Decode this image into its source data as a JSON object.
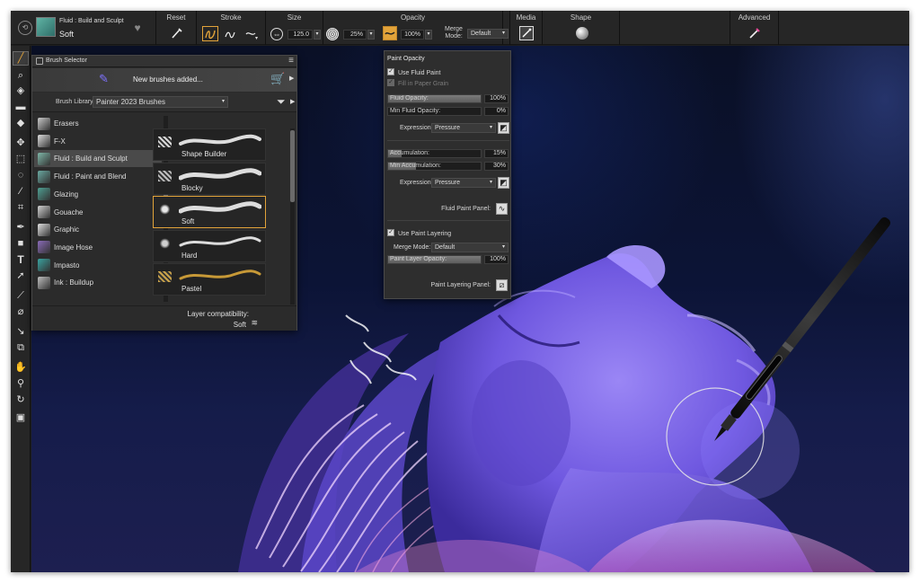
{
  "propbar": {
    "brush_category": "Fluid : Build and Sculpt",
    "brush_variant": "Soft",
    "sections": {
      "reset": "Reset",
      "stroke": "Stroke",
      "size": "Size",
      "opacity": "Opacity",
      "media": "Media",
      "shape": "Shape",
      "advanced": "Advanced"
    },
    "size_value": "125.0",
    "softness_value": "25%",
    "opacity_value": "100%",
    "merge_mode_label_1": "Merge",
    "merge_mode_label_2": "Mode:",
    "merge_mode_value": "Default",
    "chevron": "▾"
  },
  "toolbox": {
    "icons": [
      "brush-icon",
      "dropper-icon",
      "paint-bucket-icon",
      "fill-rect-icon",
      "eraser-icon",
      "transform-icon",
      "rect-select-icon",
      "lasso-icon",
      "magic-wand-icon",
      "crop-icon",
      "pen-icon",
      "shape-icon",
      "text-icon",
      "layer-adjuster-icon",
      "smudge-icon",
      "blender-icon",
      "dodge-icon",
      "clone-icon",
      "grabber-icon",
      "magnifier-icon",
      "rotate-icon",
      "navigator-icon"
    ]
  },
  "brush_selector": {
    "title": "Brush Selector",
    "banner_text": "New brushes added...",
    "library_label": "Brush Library:",
    "library_value": "Painter 2023 Brushes",
    "categories": [
      {
        "label": "Erasers",
        "color": "#c8c8c8"
      },
      {
        "label": "F-X",
        "color": "#dcdcdc"
      },
      {
        "label": "Fluid : Build and Sculpt",
        "color": "#7fb7a8"
      },
      {
        "label": "Fluid : Paint and Blend",
        "color": "#6aa9a1"
      },
      {
        "label": "Glazing",
        "color": "#4f9f92"
      },
      {
        "label": "Gouache",
        "color": "#d0d0d0"
      },
      {
        "label": "Graphic",
        "color": "#e0e0e0"
      },
      {
        "label": "Image Hose",
        "color": "#8a6bb8"
      },
      {
        "label": "Impasto",
        "color": "#3aa3a0"
      },
      {
        "label": "Ink : Buildup",
        "color": "#bdbdbd"
      }
    ],
    "active_category_index": 2,
    "variants": [
      {
        "label": "Shape Builder"
      },
      {
        "label": "Blocky"
      },
      {
        "label": "Soft"
      },
      {
        "label": "Hard"
      },
      {
        "label": "Pastel"
      }
    ],
    "active_variant_index": 2,
    "footer_label": "Layer compatibility:",
    "footer_value": "Soft",
    "colors": {
      "accent": "#e2a33a"
    }
  },
  "paint_opacity": {
    "title": "Paint Opacity",
    "use_fluid_paint": "Use Fluid Paint",
    "fill_in_paper_grain": "Fill in Paper Grain",
    "fluid_opacity": {
      "label": "Fluid Opacity:",
      "value": "100%",
      "fraction": 1.0
    },
    "min_fluid_opacity": {
      "label": "Min Fluid Opacity:",
      "value": "0%",
      "fraction": 0.0
    },
    "expression_label": "Expression:",
    "expression_value": "Pressure",
    "accumulation": {
      "label": "Accumulation:",
      "value": "15%",
      "fraction": 0.15
    },
    "min_accumulation": {
      "label": "Min Accumulation:",
      "value": "30%",
      "fraction": 0.3
    },
    "expression_value_2": "Pressure",
    "fluid_paint_panel": "Fluid Paint Panel:",
    "use_paint_layering": "Use Paint Layering",
    "merge_mode_label": "Merge Mode:",
    "merge_mode_value": "Default",
    "paint_layer_opacity": {
      "label": "Paint Layer Opacity:",
      "value": "100%",
      "fraction": 1.0
    },
    "paint_layering_panel": "Paint Layering Panel:"
  }
}
